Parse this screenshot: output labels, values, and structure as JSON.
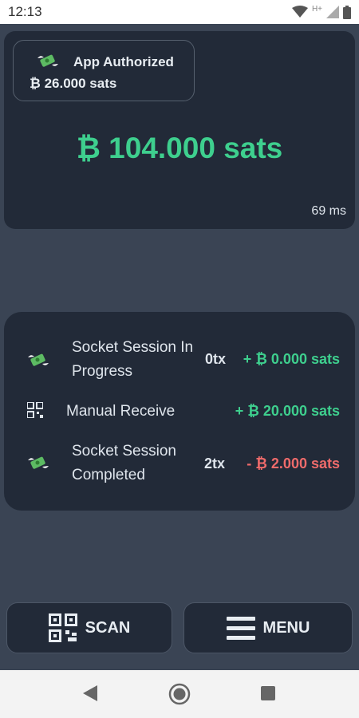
{
  "status_bar": {
    "time": "12:13",
    "network": "H+"
  },
  "auth_chip": {
    "title": "App Authorized",
    "amount": "₿ 26.000 sats"
  },
  "balance": {
    "amount": "₿ 104.000 sats",
    "latency": "69 ms"
  },
  "transactions": [
    {
      "icon": "money-wings-icon",
      "label_line1": "Socket Session In",
      "label_line2": "Progress",
      "count": "0tx",
      "amount": "+ ₿ 0.000 sats",
      "direction": "positive"
    },
    {
      "icon": "qr-code-icon",
      "label": "Manual Receive",
      "amount": "+ ₿ 20.000 sats",
      "direction": "positive"
    },
    {
      "icon": "money-wings-icon",
      "label_line1": "Socket Session",
      "label_line2": "Completed",
      "count": "2tx",
      "amount": "- ₿ 2.000 sats",
      "direction": "negative"
    }
  ],
  "buttons": {
    "scan_label": "SCAN",
    "menu_label": "MENU"
  },
  "colors": {
    "positive": "#3ecf8e",
    "negative": "#ef6b6b",
    "card": "#222a38",
    "background": "#3a4454"
  }
}
